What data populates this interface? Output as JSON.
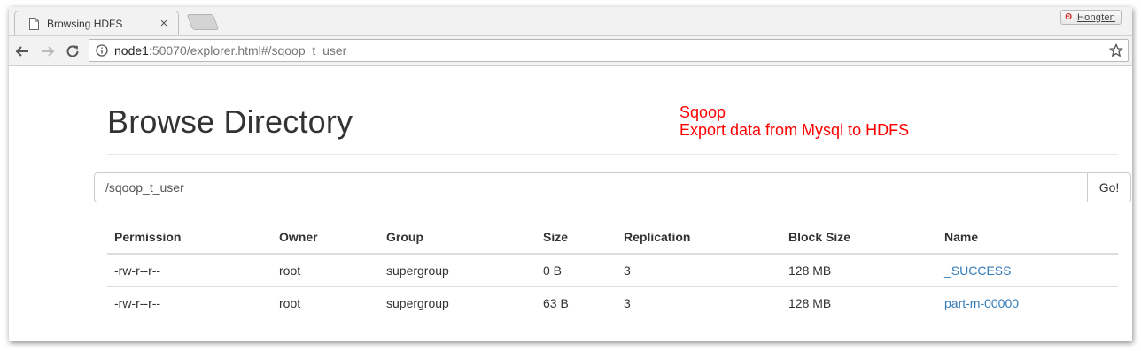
{
  "browser": {
    "tab_title": "Browsing HDFS",
    "profile_name": "Hongten",
    "url_host": "node1",
    "url_rest": ":50070/explorer.html#/sqoop_t_user"
  },
  "page": {
    "title": "Browse Directory",
    "annotation_line1": "Sqoop",
    "annotation_line2": "Export data from Mysql to HDFS",
    "annotation_color": "#ff0000",
    "link_color": "#337ab7",
    "path_value": "/sqoop_t_user",
    "go_label": "Go!"
  },
  "table": {
    "headers": [
      "Permission",
      "Owner",
      "Group",
      "Size",
      "Replication",
      "Block Size",
      "Name"
    ],
    "rows": [
      [
        "-rw-r--r--",
        "root",
        "supergroup",
        "0 B",
        "3",
        "128 MB",
        "_SUCCESS"
      ],
      [
        "-rw-r--r--",
        "root",
        "supergroup",
        "63 B",
        "3",
        "128 MB",
        "part-m-00000"
      ]
    ]
  }
}
